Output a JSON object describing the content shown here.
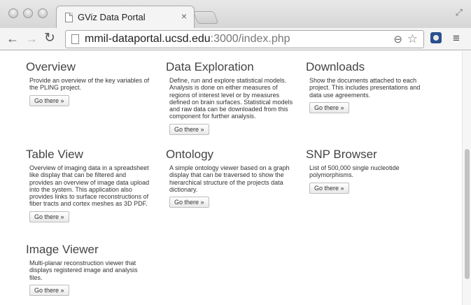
{
  "browser": {
    "tab_title": "GViz Data Portal",
    "tab_close": "×",
    "url_host": "mmil-dataportal.ucsd.edu",
    "url_rest": ":3000/index.php"
  },
  "icons": {
    "back": "←",
    "forward": "→",
    "reload": "↻",
    "zoom": "⊖",
    "star": "☆",
    "menu": "≡",
    "fullscreen": "⤢"
  },
  "cards": [
    {
      "title": "Overview",
      "description": "Provide an overview of the key variables of the PLING project.",
      "button": "Go there »"
    },
    {
      "title": "Data Exploration",
      "description": "Define, run and explore statistical models. Analysis is done on either measures of regions of interest level or by measures defined on brain surfaces. Statistical models and raw data can be downloaded from this component for further analysis.",
      "button": "Go there »"
    },
    {
      "title": "Downloads",
      "description": "Show the documents attached to each project. This includes presentations and data use agreements.",
      "button": "Go there »"
    },
    {
      "title": "Table View",
      "description": "Overview of imaging data in a spreadsheet like display that can be filtered and provides an overview of image data upload into the system. This application also provides links to surface reconstructions of fiber tracts and cortex meshes as 3D PDF.",
      "button": "Go there »"
    },
    {
      "title": "Ontology",
      "description": "A simple ontology viewer based on a graph display that can be traversed to show the hierarchical structure of the projects data dictionary.",
      "button": "Go there »"
    },
    {
      "title": "SNP Browser",
      "description": "List of 500,000 single nucleotide polymorphisms.",
      "button": "Go there »"
    },
    {
      "title": "Image Viewer",
      "description": "Multi-planar reconstruction viewer that displays registered image and analysis files.",
      "button": "Go there »"
    }
  ]
}
